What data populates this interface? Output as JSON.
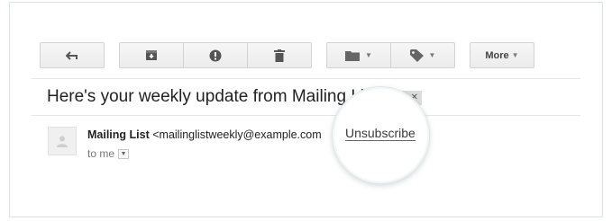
{
  "toolbar": {
    "reply_icon": "reply-icon",
    "archive_icon": "archive-icon",
    "spam_icon": "report-spam-icon",
    "delete_icon": "trash-icon",
    "folder_icon": "folder-icon",
    "label_icon": "tag-icon",
    "more_label": "More"
  },
  "message": {
    "subject": "Here's your weekly update from Mailing List",
    "sender_name": "Mailing List",
    "sender_email": "<mailinglistweekly@example.com",
    "recipient": "to me"
  },
  "callout": {
    "unsubscribe_label": "Unsubscribe"
  }
}
